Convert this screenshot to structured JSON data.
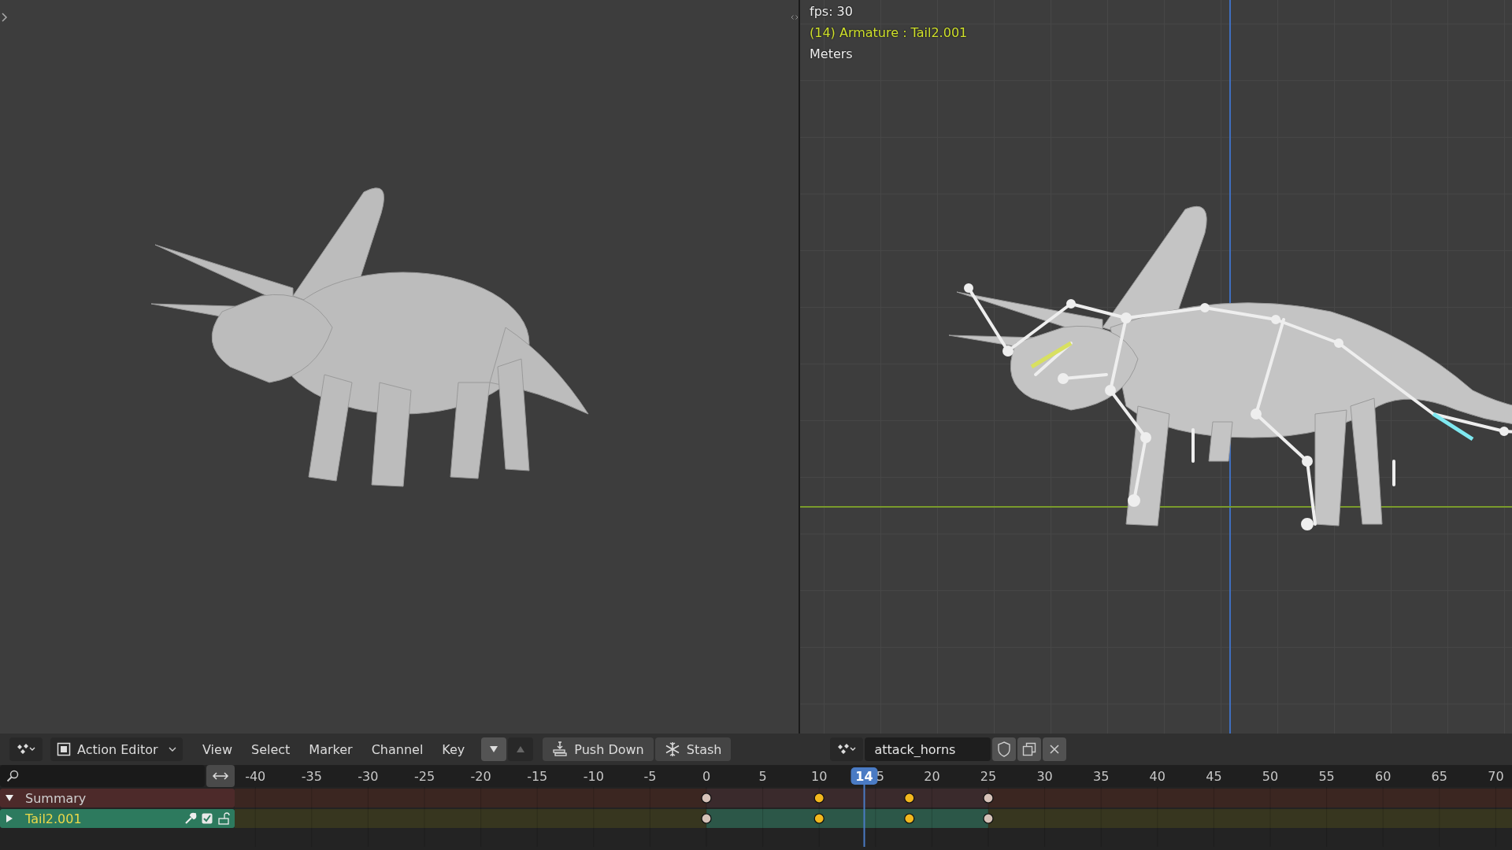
{
  "right_viewport": {
    "overlay_lines": [
      {
        "text": "fps: 30",
        "kind": "info"
      },
      {
        "text": "(14) Armature : Tail2.001",
        "kind": "active"
      },
      {
        "text": "Meters",
        "kind": "info"
      }
    ]
  },
  "header": {
    "editor_mode": "Action Editor",
    "menus": [
      "View",
      "Select",
      "Marker",
      "Channel",
      "Key"
    ],
    "buttons": [
      {
        "label": "Push Down",
        "kind": "push-down"
      },
      {
        "label": "Stash",
        "kind": "stash"
      }
    ],
    "action": {
      "value": "attack_horns"
    }
  },
  "timeline": {
    "ruler_labels": [
      "-40",
      "-35",
      "-30",
      "-25",
      "-20",
      "-15",
      "-10",
      "-5",
      "0",
      "5",
      "10",
      "5",
      "20",
      "25",
      "30",
      "35",
      "40",
      "45",
      "50",
      "55",
      "60",
      "65",
      "70"
    ],
    "playhead": {
      "frame": "14",
      "level": 0.4929
    }
  },
  "channels": [
    {
      "name": "Summary",
      "kind": "summary",
      "expanded": true,
      "keyframes": [
        {
          "level": 0.3693,
          "selected": false
        },
        {
          "level": 0.4576,
          "selected": true
        },
        {
          "level": 0.5282,
          "selected": true
        },
        {
          "level": 0.59,
          "selected": false
        }
      ]
    },
    {
      "name": "Tail2.001",
      "kind": "group",
      "expanded": false,
      "checked": true,
      "keyframes": [
        {
          "level": 0.3693,
          "selected": false
        },
        {
          "level": 0.4576,
          "selected": true
        },
        {
          "level": 0.5282,
          "selected": true
        },
        {
          "level": 0.59,
          "selected": false
        }
      ]
    }
  ]
}
